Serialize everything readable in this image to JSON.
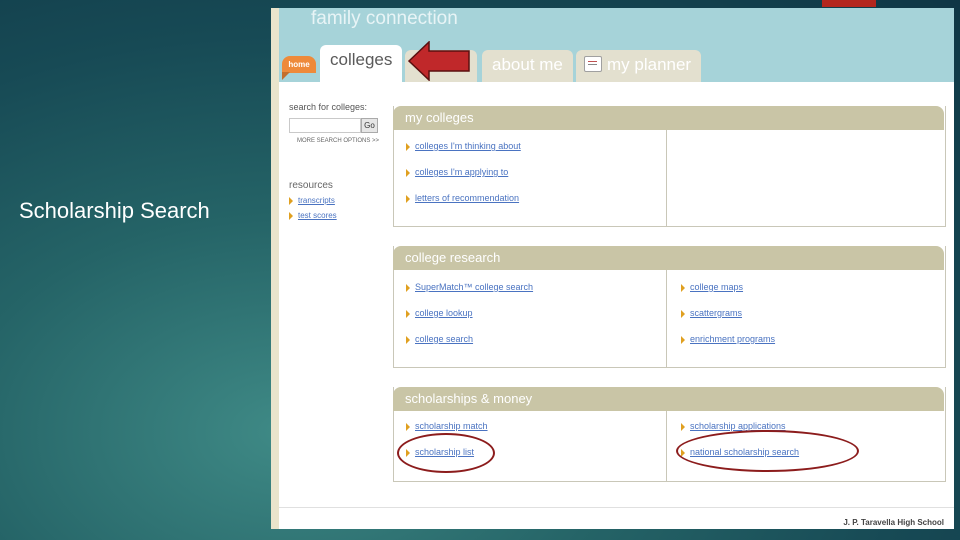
{
  "slide": {
    "title": "Scholarship Search"
  },
  "app": {
    "brand": "family connection"
  },
  "tabs": {
    "home": "home",
    "colleges": "colleges",
    "about_me": "about me",
    "my_planner": "my planner"
  },
  "sidebar": {
    "search_label": "search for colleges:",
    "search_value": "",
    "go_label": "Go",
    "more_search": "MORE SEARCH OPTIONS >>",
    "resources_title": "resources",
    "resources": [
      "transcripts",
      "test scores"
    ]
  },
  "panels": {
    "my_colleges": {
      "title": "my colleges",
      "left_links": [
        "colleges I'm thinking about",
        "colleges I'm applying to",
        "letters of recommendation"
      ]
    },
    "college_research": {
      "title": "college research",
      "left_links": [
        "SuperMatch™ college search",
        "college lookup",
        "college search"
      ],
      "right_links": [
        "college maps",
        "scattergrams",
        "enrichment programs"
      ]
    },
    "scholarships": {
      "title": "scholarships & money",
      "left_links": [
        "scholarship match",
        "scholarship list"
      ],
      "right_links": [
        "scholarship applications",
        "national scholarship search"
      ]
    }
  },
  "footer": {
    "school": "J. P. Taravella High School"
  },
  "colors": {
    "highlight_annotation": "#8c1c1c",
    "arrow": "#c0282a",
    "header": "#a6d3d9"
  }
}
